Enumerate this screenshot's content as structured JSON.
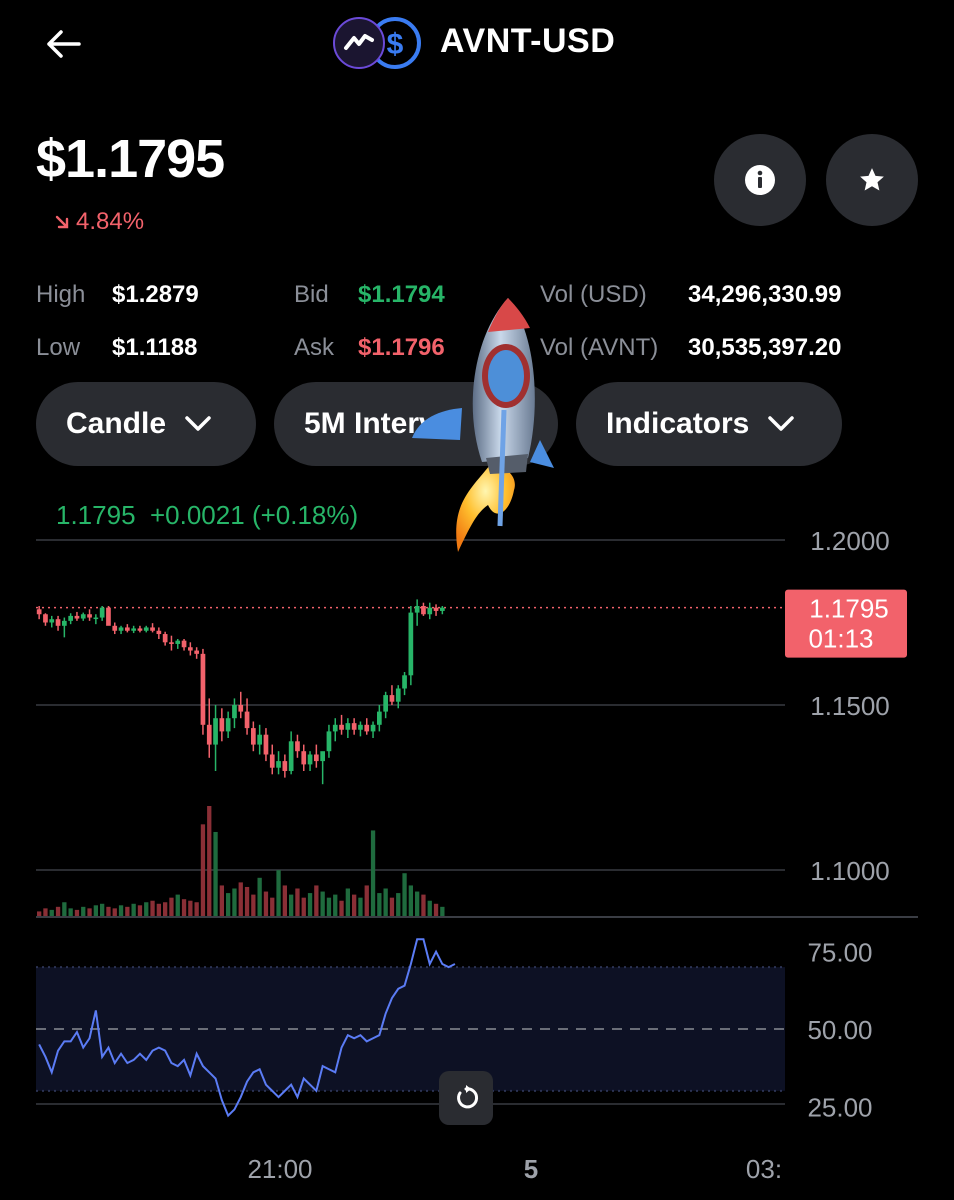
{
  "header": {
    "title": "AVNT-USD",
    "back_icon": "arrow-left-icon"
  },
  "price": {
    "value": "$1.1795",
    "change": "4.84%",
    "change_direction": "down"
  },
  "actions": {
    "info_icon": "info-icon",
    "star_icon": "star-icon"
  },
  "stats": {
    "high_label": "High",
    "high_value": "$1.2879",
    "low_label": "Low",
    "low_value": "$1.1188",
    "bid_label": "Bid",
    "bid_value": "$1.1794",
    "ask_label": "Ask",
    "ask_value": "$1.1796",
    "vol_usd_label": "Vol (USD)",
    "vol_usd_value": "34,296,330.99",
    "vol_avnt_label": "Vol (AVNT)",
    "vol_avnt_value": "30,535,397.20"
  },
  "controls": {
    "chart_type": "Candle",
    "interval": "5M Interval",
    "indicators": "Indicators"
  },
  "chart_info": {
    "last": "1.1795",
    "change": "+0.0021",
    "change_pct": "(+0.18%)"
  },
  "colors": {
    "up": "#27b568",
    "down": "#f2626b",
    "rsi_line": "#5b7cf5",
    "background": "#000000"
  },
  "chart_data": [
    {
      "type": "candlestick",
      "y_ticks": [
        "1.2000",
        "1.1500",
        "1.1000"
      ],
      "ylim": [
        1.1,
        1.2
      ],
      "x_ticks": [
        "21:00",
        "5",
        "03:"
      ],
      "current_price_label": "1.1795",
      "countdown_label": "01:13",
      "current_price": 1.1795,
      "candles": [
        [
          1.179,
          1.18,
          1.176,
          1.1775
        ],
        [
          1.1775,
          1.1778,
          1.174,
          1.175
        ],
        [
          1.175,
          1.177,
          1.1735,
          1.176
        ],
        [
          1.176,
          1.177,
          1.1725,
          1.174
        ],
        [
          1.174,
          1.1765,
          1.1705,
          1.1755
        ],
        [
          1.1755,
          1.1778,
          1.1745,
          1.177
        ],
        [
          1.177,
          1.1782,
          1.1755,
          1.1762
        ],
        [
          1.1762,
          1.178,
          1.1755,
          1.1775
        ],
        [
          1.1775,
          1.179,
          1.1755,
          1.1765
        ],
        [
          1.1765,
          1.1775,
          1.1745,
          1.1765
        ],
        [
          1.1765,
          1.18,
          1.1755,
          1.1795
        ],
        [
          1.1795,
          1.18,
          1.1745,
          1.174
        ],
        [
          1.174,
          1.175,
          1.1715,
          1.1725
        ],
        [
          1.1725,
          1.174,
          1.1715,
          1.1735
        ],
        [
          1.1735,
          1.1745,
          1.172,
          1.1725
        ],
        [
          1.1725,
          1.174,
          1.1718,
          1.1732
        ],
        [
          1.1732,
          1.174,
          1.172,
          1.1725
        ],
        [
          1.1725,
          1.174,
          1.172,
          1.1735
        ],
        [
          1.1735,
          1.1748,
          1.172,
          1.1725
        ],
        [
          1.1725,
          1.1735,
          1.17,
          1.1715
        ],
        [
          1.1715,
          1.1722,
          1.168,
          1.169
        ],
        [
          1.169,
          1.171,
          1.1665,
          1.1685
        ],
        [
          1.1685,
          1.17,
          1.167,
          1.1695
        ],
        [
          1.1695,
          1.17,
          1.1665,
          1.1675
        ],
        [
          1.1675,
          1.169,
          1.165,
          1.1665
        ],
        [
          1.1665,
          1.1675,
          1.164,
          1.1655
        ],
        [
          1.1655,
          1.167,
          1.141,
          1.144
        ],
        [
          1.144,
          1.152,
          1.134,
          1.138
        ],
        [
          1.138,
          1.15,
          1.13,
          1.146
        ],
        [
          1.146,
          1.149,
          1.139,
          1.142
        ],
        [
          1.142,
          1.148,
          1.14,
          1.146
        ],
        [
          1.146,
          1.152,
          1.143,
          1.15
        ],
        [
          1.15,
          1.154,
          1.146,
          1.148
        ],
        [
          1.148,
          1.152,
          1.141,
          1.143
        ],
        [
          1.143,
          1.145,
          1.136,
          1.138
        ],
        [
          1.138,
          1.144,
          1.135,
          1.141
        ],
        [
          1.141,
          1.143,
          1.133,
          1.135
        ],
        [
          1.135,
          1.138,
          1.129,
          1.131
        ],
        [
          1.131,
          1.136,
          1.129,
          1.133
        ],
        [
          1.133,
          1.135,
          1.128,
          1.13
        ],
        [
          1.13,
          1.142,
          1.129,
          1.139
        ],
        [
          1.139,
          1.141,
          1.134,
          1.136
        ],
        [
          1.136,
          1.138,
          1.13,
          1.132
        ],
        [
          1.132,
          1.136,
          1.13,
          1.135
        ],
        [
          1.135,
          1.138,
          1.131,
          1.133
        ],
        [
          1.133,
          1.135,
          1.126,
          1.136
        ],
        [
          1.136,
          1.144,
          1.134,
          1.142
        ],
        [
          1.142,
          1.146,
          1.139,
          1.144
        ],
        [
          1.144,
          1.147,
          1.141,
          1.1425
        ],
        [
          1.1425,
          1.146,
          1.14,
          1.1445
        ],
        [
          1.1445,
          1.146,
          1.141,
          1.1425
        ],
        [
          1.1425,
          1.145,
          1.1405,
          1.144
        ],
        [
          1.144,
          1.146,
          1.141,
          1.142
        ],
        [
          1.142,
          1.145,
          1.14,
          1.144
        ],
        [
          1.144,
          1.15,
          1.142,
          1.148
        ],
        [
          1.148,
          1.154,
          1.146,
          1.153
        ],
        [
          1.153,
          1.156,
          1.15,
          1.151
        ],
        [
          1.151,
          1.156,
          1.149,
          1.155
        ],
        [
          1.155,
          1.16,
          1.153,
          1.159
        ],
        [
          1.159,
          1.18,
          1.156,
          1.178
        ],
        [
          1.178,
          1.182,
          1.174,
          1.18
        ],
        [
          1.18,
          1.181,
          1.177,
          1.1775
        ],
        [
          1.1775,
          1.181,
          1.176,
          1.1795
        ],
        [
          1.1795,
          1.1805,
          1.177,
          1.1785
        ],
        [
          1.1785,
          1.18,
          1.1775,
          1.1795
        ]
      ],
      "volumes": [
        3,
        5,
        4,
        6,
        9,
        5,
        4,
        6,
        5,
        7,
        8,
        6,
        5,
        7,
        6,
        8,
        7,
        9,
        10,
        8,
        9,
        12,
        14,
        11,
        10,
        9,
        60,
        72,
        55,
        20,
        15,
        18,
        22,
        19,
        14,
        25,
        16,
        12,
        30,
        20,
        14,
        18,
        12,
        15,
        20,
        16,
        12,
        14,
        10,
        18,
        14,
        12,
        20,
        56,
        15,
        18,
        12,
        15,
        28,
        20,
        16,
        14,
        10,
        8,
        6
      ]
    },
    {
      "type": "line",
      "name": "",
      "y_ticks": [
        "75.00",
        "50.00",
        "25.00"
      ],
      "ylim": [
        18,
        82
      ],
      "band": [
        30,
        70
      ],
      "midline": 50,
      "values": [
        45,
        41,
        36,
        43,
        46,
        46,
        49,
        44,
        47,
        56,
        41,
        44,
        39,
        42,
        39,
        40,
        42,
        40,
        43,
        44,
        43,
        39,
        38,
        40,
        35,
        42,
        38,
        36,
        34,
        27,
        22,
        24,
        28,
        33,
        36,
        37,
        32,
        30,
        28,
        30,
        32,
        28,
        34,
        32,
        30,
        38,
        37,
        36,
        44,
        48,
        47,
        48,
        46,
        47,
        48,
        55,
        60,
        63,
        64,
        71,
        79,
        79,
        71,
        75,
        71,
        70,
        71
      ]
    }
  ]
}
